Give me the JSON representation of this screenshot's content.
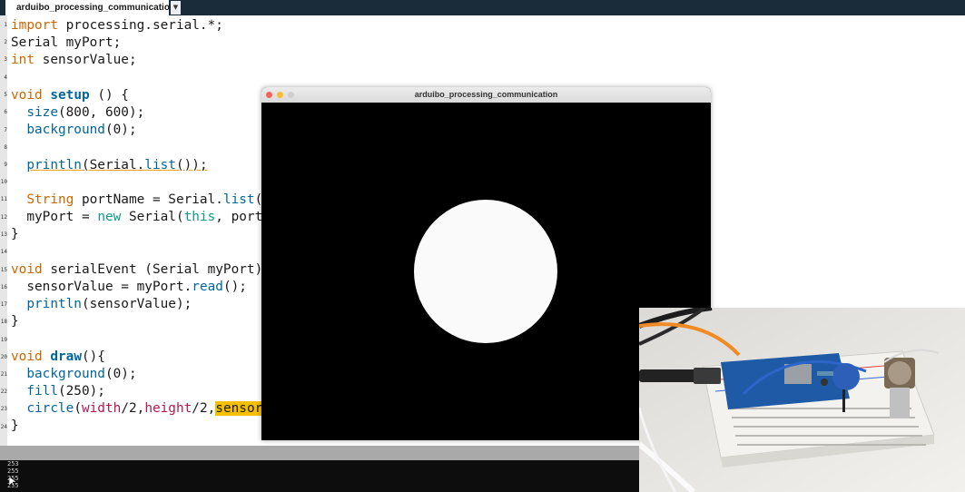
{
  "tab": {
    "label": "arduibo_processing_communication",
    "menu_glyph": "▼"
  },
  "editor": {
    "line_numbers": [
      "1",
      "2",
      "3",
      "4",
      "5",
      "6",
      "7",
      "8",
      "9",
      "10",
      "11",
      "12",
      "13",
      "14",
      "15",
      "16",
      "17",
      "18",
      "19",
      "20",
      "21",
      "22",
      "23",
      "24"
    ],
    "code": {
      "l1": {
        "a": "import",
        "b": " processing.serial.*;"
      },
      "l2": {
        "a": "Serial myPort;"
      },
      "l3": {
        "a": "int",
        "b": " sensorValue;"
      },
      "l5": {
        "a": "void",
        "b": " ",
        "c": "setup",
        "d": " () {"
      },
      "l6": {
        "a": "  ",
        "b": "size",
        "c": "(800, 600);"
      },
      "l7": {
        "a": "  ",
        "b": "background",
        "c": "(0);"
      },
      "l9": {
        "a": "  ",
        "b": "println",
        "c": "(Serial.",
        "d": "list",
        "e": "());"
      },
      "l11": {
        "a": "  ",
        "b": "String",
        "c": " portName = Serial.",
        "d": "list",
        "e": "("
      },
      "l12": {
        "a": "  myPort = ",
        "b": "new",
        "c": " Serial(",
        "d": "this",
        "e": ", port"
      },
      "l13": {
        "a": "}"
      },
      "l15": {
        "a": "void",
        "b": " serialEvent (Serial myPort)"
      },
      "l16": {
        "a": "  sensorValue = myPort.",
        "b": "read",
        "c": "();"
      },
      "l17": {
        "a": "  ",
        "b": "println",
        "c": "(sensorValue);"
      },
      "l18": {
        "a": "}"
      },
      "l20": {
        "a": "void",
        "b": " ",
        "c": "draw",
        "d": "(){"
      },
      "l21": {
        "a": "  ",
        "b": "background",
        "c": "(0);"
      },
      "l22": {
        "a": "  ",
        "b": "fill",
        "c": "(250);"
      },
      "l23": {
        "a": "  ",
        "b": "circle",
        "c": "(",
        "d": "width",
        "e": "/2,",
        "f": "height",
        "g": "/2,",
        "h": "sensor"
      },
      "l24": {
        "a": "}"
      }
    }
  },
  "console": {
    "lines": [
      "253",
      "255",
      "255",
      "255"
    ]
  },
  "sketch_window": {
    "title": "arduibo_processing_communication",
    "fill_value": 250
  },
  "webcam": {
    "description_icon": "arduino-breadboard-photo"
  },
  "colors": {
    "keyword_orange": "#cc6600",
    "keyword_green": "#0e9a83",
    "function_blue": "#006699",
    "builtin_pink": "#b5174f",
    "highlight": "#f6c000",
    "tabbar": "#1a2c3a"
  }
}
